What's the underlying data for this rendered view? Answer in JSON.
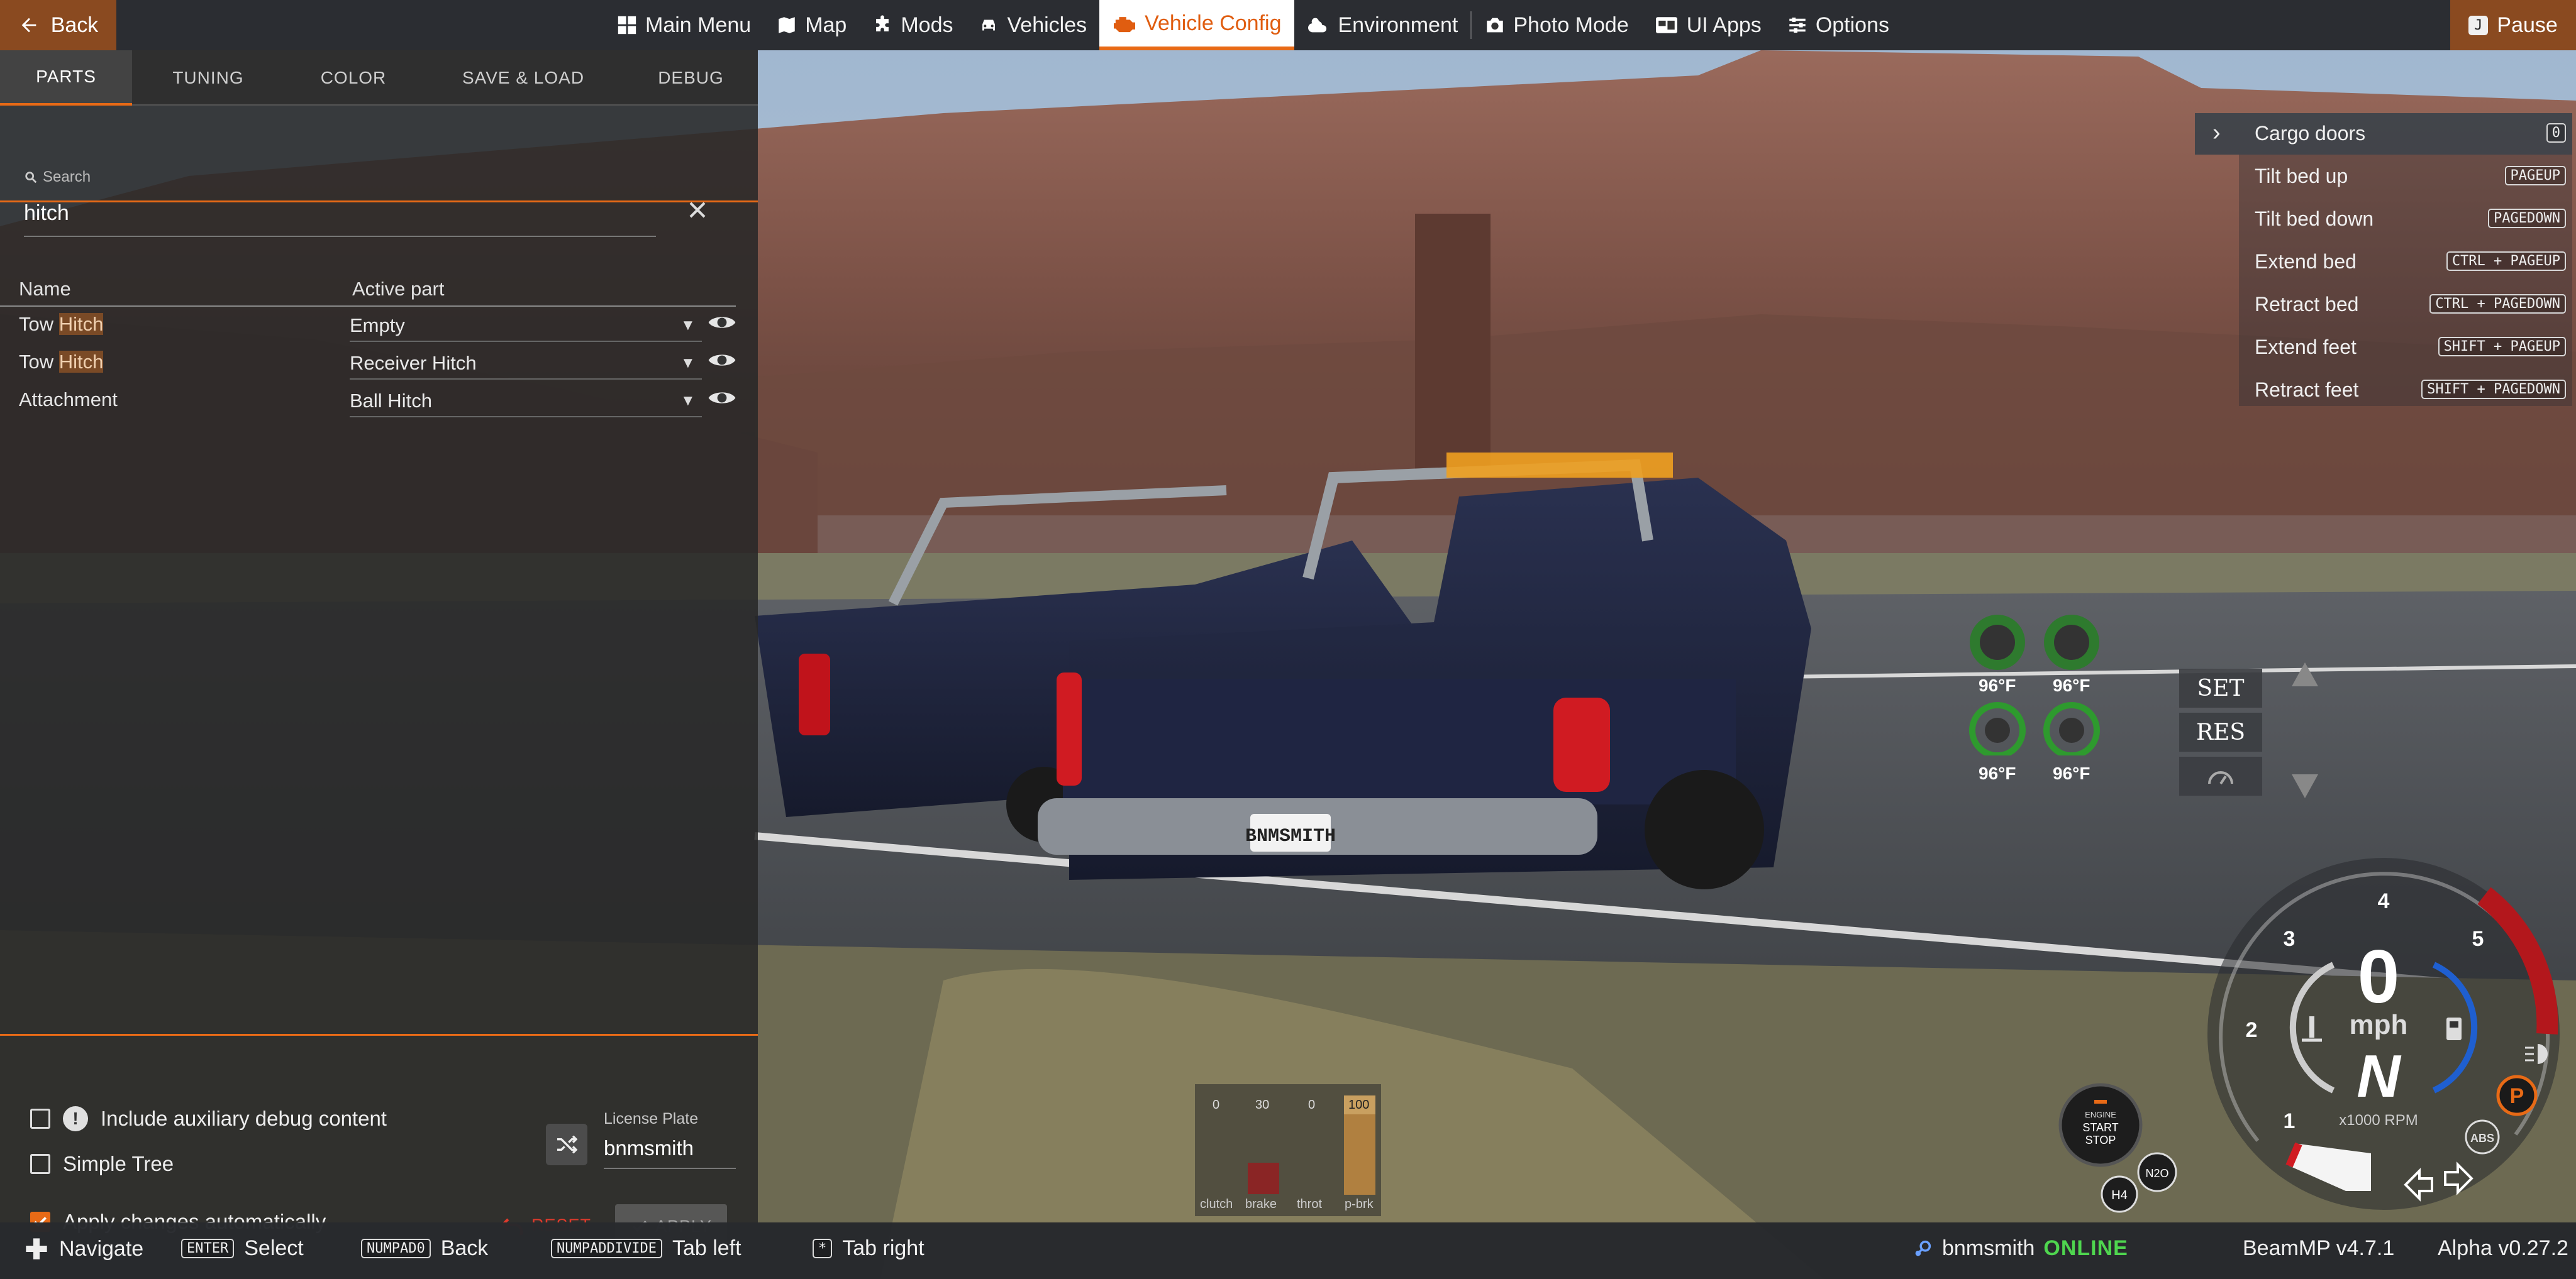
{
  "topbar": {
    "back_label": "Back",
    "nav": [
      {
        "label": "Main Menu",
        "icon": "main-menu-icon"
      },
      {
        "label": "Map",
        "icon": "map-icon"
      },
      {
        "label": "Mods",
        "icon": "puzzle-icon"
      },
      {
        "label": "Vehicles",
        "icon": "car-icon"
      },
      {
        "label": "Vehicle Config",
        "icon": "engine-icon",
        "active": true
      },
      {
        "label": "Environment",
        "icon": "sun-cloud-icon"
      },
      {
        "label": "Photo Mode",
        "icon": "camera-icon"
      },
      {
        "label": "UI Apps",
        "icon": "ui-apps-icon"
      },
      {
        "label": "Options",
        "icon": "sliders-icon"
      }
    ],
    "pause_key": "J",
    "pause_label": "Pause"
  },
  "panel": {
    "tabs": [
      "PARTS",
      "TUNING",
      "COLOR",
      "SAVE & LOAD",
      "DEBUG"
    ],
    "active_tab": "PARTS",
    "search": {
      "label": "Search",
      "value": "hitch"
    },
    "columns": {
      "name": "Name",
      "active_part": "Active part"
    },
    "rows": [
      {
        "name_prefix": "Tow ",
        "name_match": "Hitch",
        "part": "Empty"
      },
      {
        "name_prefix": "Tow ",
        "name_match": "Hitch",
        "part": "Receiver Hitch"
      },
      {
        "name_prefix": "Attachment",
        "name_match": "",
        "part": "Ball Hitch"
      }
    ],
    "options": {
      "aux_debug": "Include auxiliary debug content",
      "simple_tree": "Simple Tree",
      "apply_auto": "Apply changes automatically"
    },
    "license_plate": {
      "label": "License Plate",
      "value": "bnmsmith"
    },
    "reset_label": "RESET",
    "apply_label": "APPLY"
  },
  "bindings": [
    {
      "label": "Cargo doors",
      "key": "0"
    },
    {
      "label": "Tilt bed up",
      "key": "PAGEUP"
    },
    {
      "label": "Tilt bed down",
      "key": "PAGEDOWN"
    },
    {
      "label": "Extend bed",
      "key": "CTRL + PAGEUP"
    },
    {
      "label": "Retract bed",
      "key": "CTRL + PAGEDOWN"
    },
    {
      "label": "Extend feet",
      "key": "SHIFT + PAGEUP"
    },
    {
      "label": "Retract feet",
      "key": "SHIFT + PAGEDOWN"
    }
  ],
  "hud": {
    "tire_temps": [
      "96°F",
      "96°F",
      "96°F",
      "96°F"
    ],
    "cruise": {
      "set": "SET",
      "res": "RES"
    },
    "speed": "0",
    "speed_unit": "mph",
    "gear": "N",
    "rpm_label": "x1000 RPM",
    "rpm_ticks": [
      "1",
      "2",
      "3",
      "4",
      "5"
    ],
    "engine_button": {
      "line1": "ENGINE",
      "line2": "START",
      "line3": "STOP"
    },
    "parking_brake": "P",
    "abs": "ABS",
    "nos": "N2O",
    "range": "H4",
    "pedals": [
      {
        "name": "clutch",
        "value": "0"
      },
      {
        "name": "brake",
        "value": "30"
      },
      {
        "name": "throt",
        "value": "0"
      },
      {
        "name": "p-brk",
        "value": "100"
      }
    ]
  },
  "plate_text": "BNMSMITH",
  "bottombar": {
    "hints": [
      {
        "key": "",
        "label": "Navigate"
      },
      {
        "key": "ENTER",
        "label": "Select"
      },
      {
        "key": "NUMPAD0",
        "label": "Back"
      },
      {
        "key": "NUMPADDIVIDE",
        "label": "Tab left"
      },
      {
        "key": "*",
        "label": "Tab right"
      }
    ],
    "username": "bnmsmith",
    "status": "ONLINE",
    "mp_version": "BeamMP v4.7.1",
    "game_version": "Alpha v0.27.2"
  },
  "colors": {
    "accent": "#e86a16",
    "online": "#4fd64f",
    "reset": "#e03a2c"
  }
}
